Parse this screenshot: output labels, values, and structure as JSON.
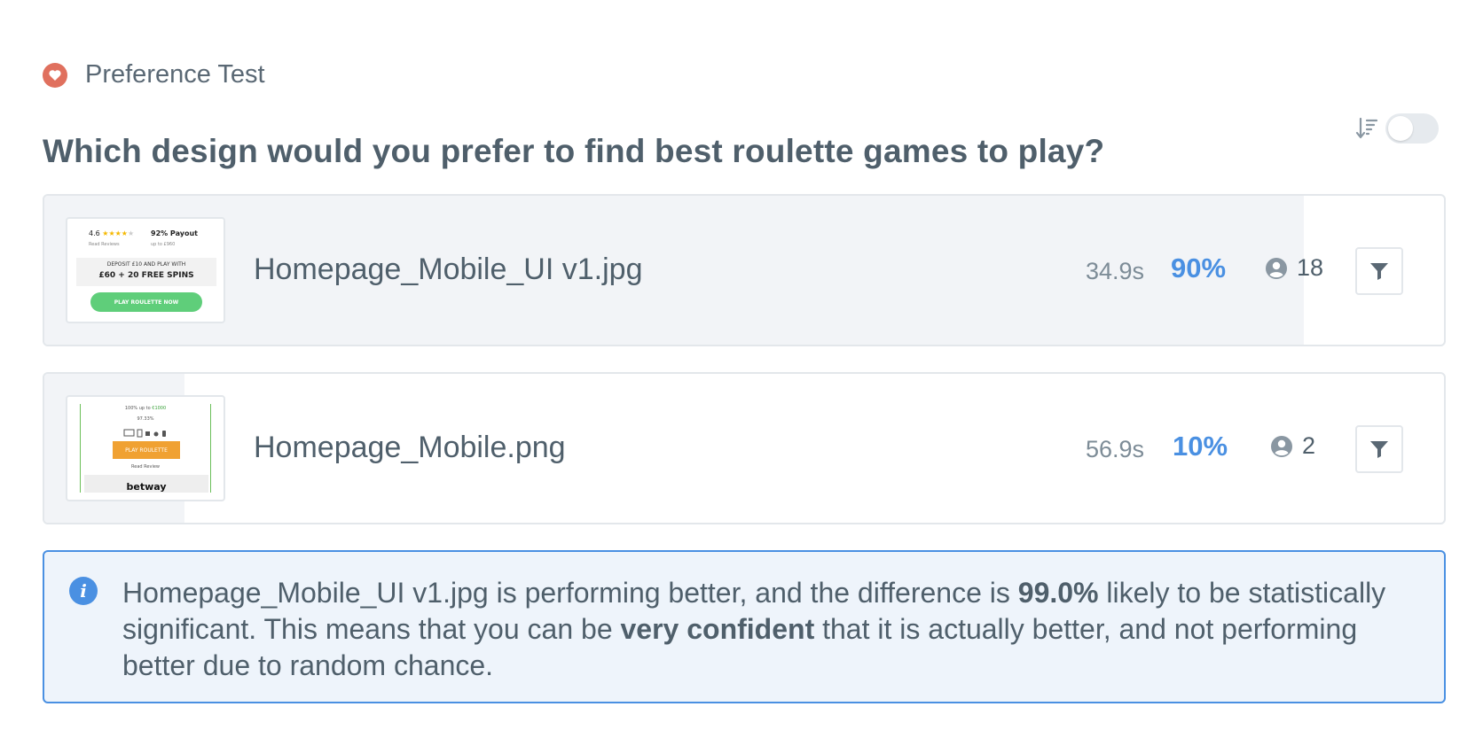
{
  "header": {
    "test_type": "Preference Test"
  },
  "question": "Which design would you prefer to find best roulette games to play?",
  "results": [
    {
      "file_name": "Homepage_Mobile_UI v1.jpg",
      "time": "34.9s",
      "percent_label": "90%",
      "share": 0.9,
      "count": "18",
      "thumbnail": {
        "rating": "4.6",
        "rating_sub": "Read Reviews",
        "payout": "92% Payout",
        "payout_sub": "up to £960",
        "deposit": "DEPOSIT £10 AND PLAY WITH",
        "offer": "£60 + 20 FREE SPINS",
        "cta": "PLAY ROULETTE NOW"
      }
    },
    {
      "file_name": "Homepage_Mobile.png",
      "time": "56.9s",
      "percent_label": "10%",
      "share": 0.1,
      "count": "2",
      "thumbnail": {
        "bonus_prefix": "100% up to ",
        "bonus_amount": "€1000",
        "payout": "97.33%",
        "cta": "PLAY ROULETTE",
        "reviews": "Read Review",
        "brand": "betway"
      }
    }
  ],
  "insight": {
    "lead": "Homepage_Mobile_UI v1.jpg is performing better, and the difference is ",
    "confidence": "99.0%",
    "middle": " likely to be statistically significant. This means that you can be ",
    "strength": "very confident",
    "tail": " that it is actually better, and not performing better due to random chance."
  },
  "colors": {
    "accent": "#4a90e2",
    "heart": "#e0705e",
    "bar": "#f2f4f7"
  },
  "icons": [
    "heart-icon",
    "sort-icon",
    "user-icon",
    "filter-icon",
    "info-icon"
  ]
}
